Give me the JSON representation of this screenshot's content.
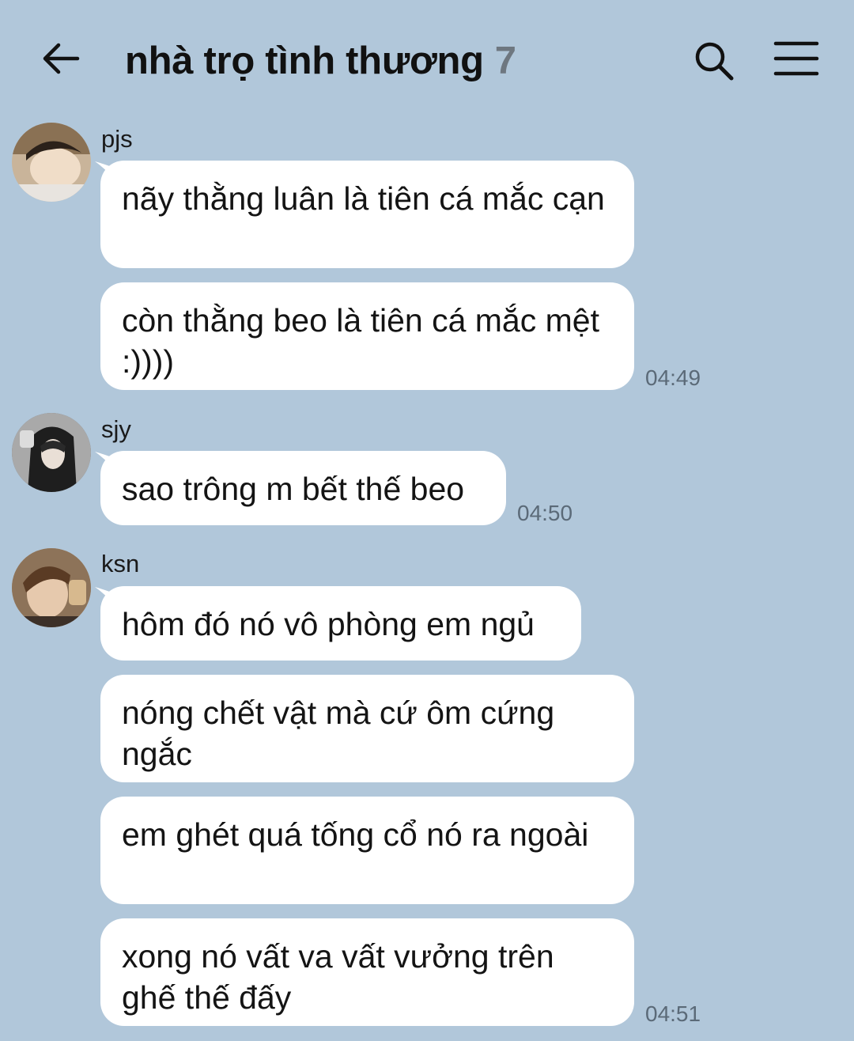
{
  "header": {
    "title": "nhà trọ tình thương",
    "member_count": "7",
    "back_icon": "arrow-left-icon",
    "search_icon": "search-icon",
    "menu_icon": "hamburger-menu-icon"
  },
  "colors": {
    "background": "#b1c7da",
    "bubble": "#ffffff",
    "timestamp": "#5b6a78",
    "member_count": "#6e7780"
  },
  "messages": [
    {
      "sender": "pjs",
      "bubbles": [
        "nãy thằng luân là tiên cá mắc cạn",
        "còn thằng beo là tiên cá mắc mệt :))))"
      ],
      "time": "04:49"
    },
    {
      "sender": "sjy",
      "bubbles": [
        "sao trông m bết thế beo"
      ],
      "time": "04:50"
    },
    {
      "sender": "ksn",
      "bubbles": [
        "hôm đó nó vô phòng em ngủ",
        "nóng chết vật mà cứ ôm cứng ngắc",
        "em ghét quá tống cổ nó ra ngoài",
        "xong nó vất va vất vưởng trên ghế thế đấy"
      ],
      "time": "04:51"
    }
  ]
}
